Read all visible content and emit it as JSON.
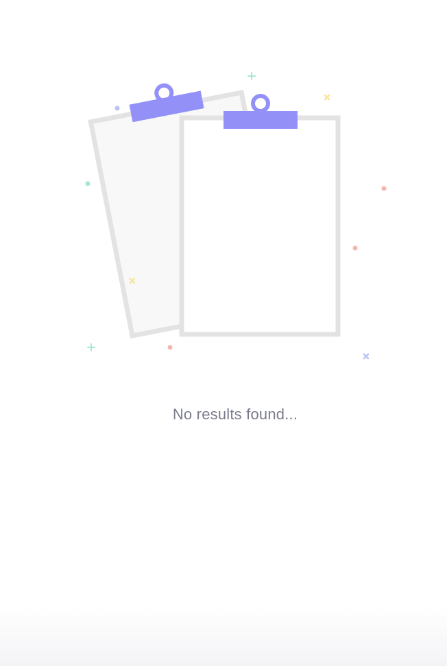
{
  "empty_state": {
    "message": "No results found..."
  },
  "icons": {
    "illustration": "empty-clipboards-illustration"
  },
  "colors": {
    "accent": "#9391f7",
    "paper_border": "#e3e3e3",
    "paper_back_fill": "#f8f8f8",
    "paper_front_fill": "#ffffff",
    "text": "#7b7d8c",
    "confetti_teal": "#a7e9cf",
    "confetti_blue": "#b9c4f5",
    "confetti_yellow": "#f7e59a",
    "confetti_red": "#f5b7ac"
  }
}
